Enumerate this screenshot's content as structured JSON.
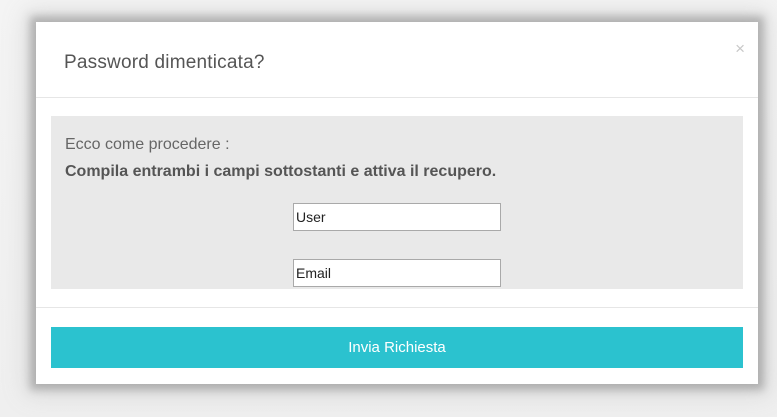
{
  "dialog": {
    "title": "Password dimenticata?",
    "close_label": "×"
  },
  "body": {
    "intro": "Ecco come procedere :",
    "instruction": "Compila entrambi i campi sottostanti e attiva il recupero.",
    "user_field": {
      "value": "",
      "placeholder": "User"
    },
    "email_field": {
      "value": "",
      "placeholder": "Email"
    }
  },
  "footer": {
    "submit_label": "Invia Richiesta"
  },
  "colors": {
    "accent": "#2bc2cf",
    "body_panel": "#e9e9e9"
  }
}
